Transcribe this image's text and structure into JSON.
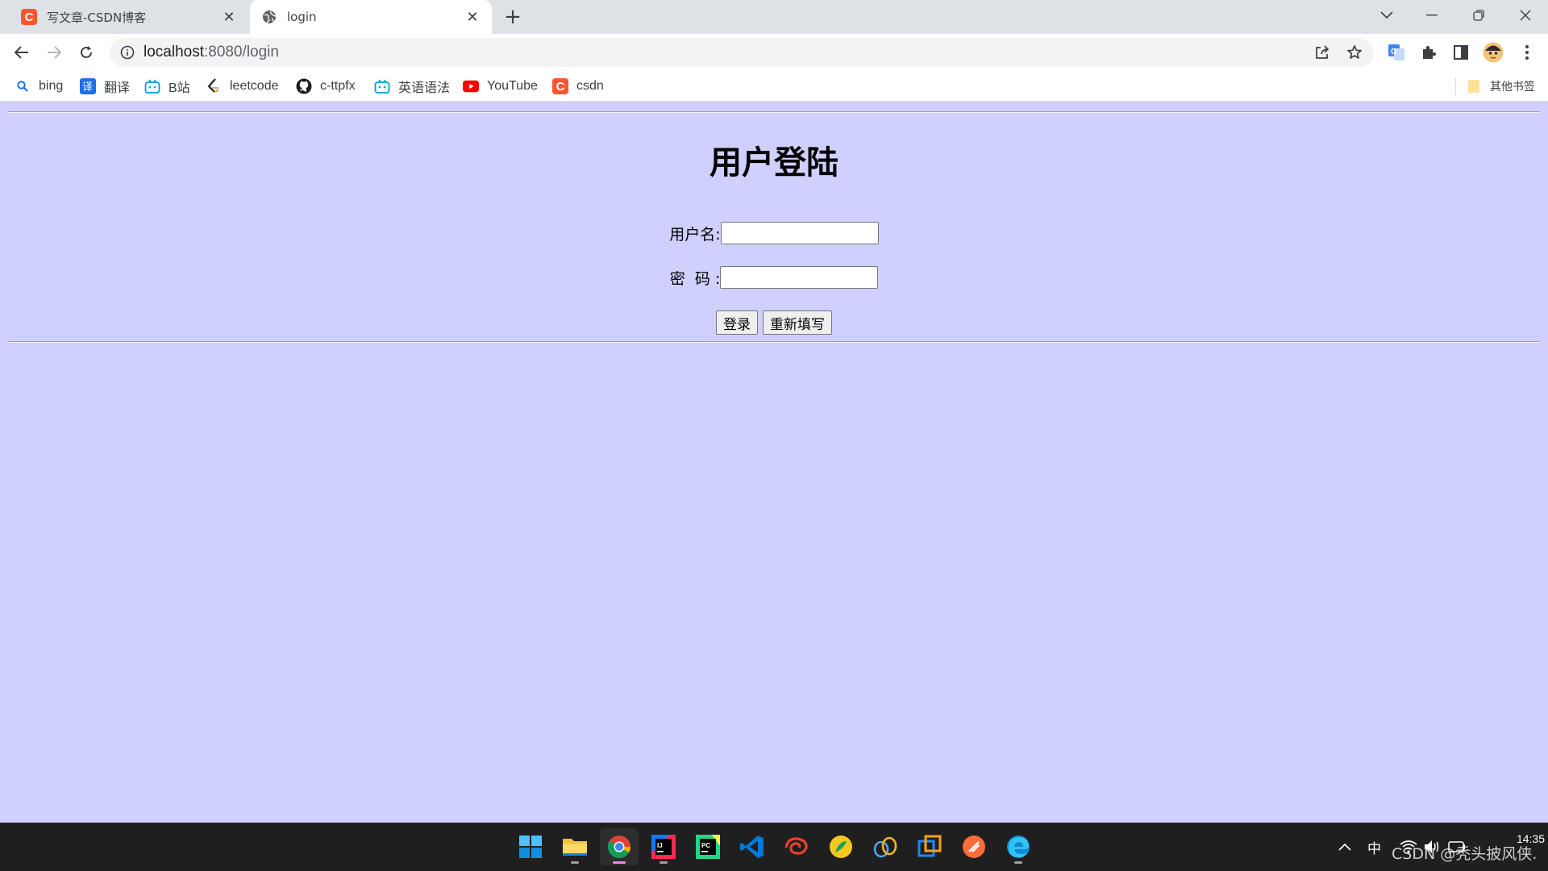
{
  "browser": {
    "tabs": [
      {
        "title": "写文章-CSDN博客",
        "favicon": "csdn-icon",
        "active": false
      },
      {
        "title": "login",
        "favicon": "globe-icon",
        "active": true
      }
    ],
    "new_tab_symbol": "+",
    "address_bar": {
      "host": "localhost",
      "path": ":8080/login"
    },
    "bookmarks": [
      {
        "label": "bing",
        "icon": "search-icon"
      },
      {
        "label": "翻译",
        "icon": "translate-icon"
      },
      {
        "label": "B站",
        "icon": "bilibili-icon"
      },
      {
        "label": "leetcode",
        "icon": "leetcode-icon"
      },
      {
        "label": "c-ttpfx",
        "icon": "github-icon"
      },
      {
        "label": "英语语法",
        "icon": "bilibili-icon"
      },
      {
        "label": "YouTube",
        "icon": "youtube-icon"
      },
      {
        "label": "csdn",
        "icon": "csdn-icon"
      }
    ],
    "other_bookmarks": "其他书签",
    "colors": {
      "accent": "#1a73e8",
      "tabstrip": "#dee1e6",
      "page_bg": "#cfd0fd"
    }
  },
  "page": {
    "heading": "用户登陆",
    "username_label": "用户名:",
    "username_value": "",
    "password_label": "密  码 :",
    "password_value": "",
    "login_button": "登录",
    "reset_button": "重新填写"
  },
  "taskbar": {
    "apps": [
      "windows-start-icon",
      "file-explorer-icon",
      "chrome-icon",
      "intellij-idea-icon",
      "pycharm-icon",
      "vscode-icon",
      "app-icon",
      "app-icon",
      "app-icon",
      "app-icon",
      "app-icon",
      "edge-icon"
    ],
    "ime": "中",
    "time": "14:35",
    "watermark": "CSDN @秃头披风侠."
  }
}
